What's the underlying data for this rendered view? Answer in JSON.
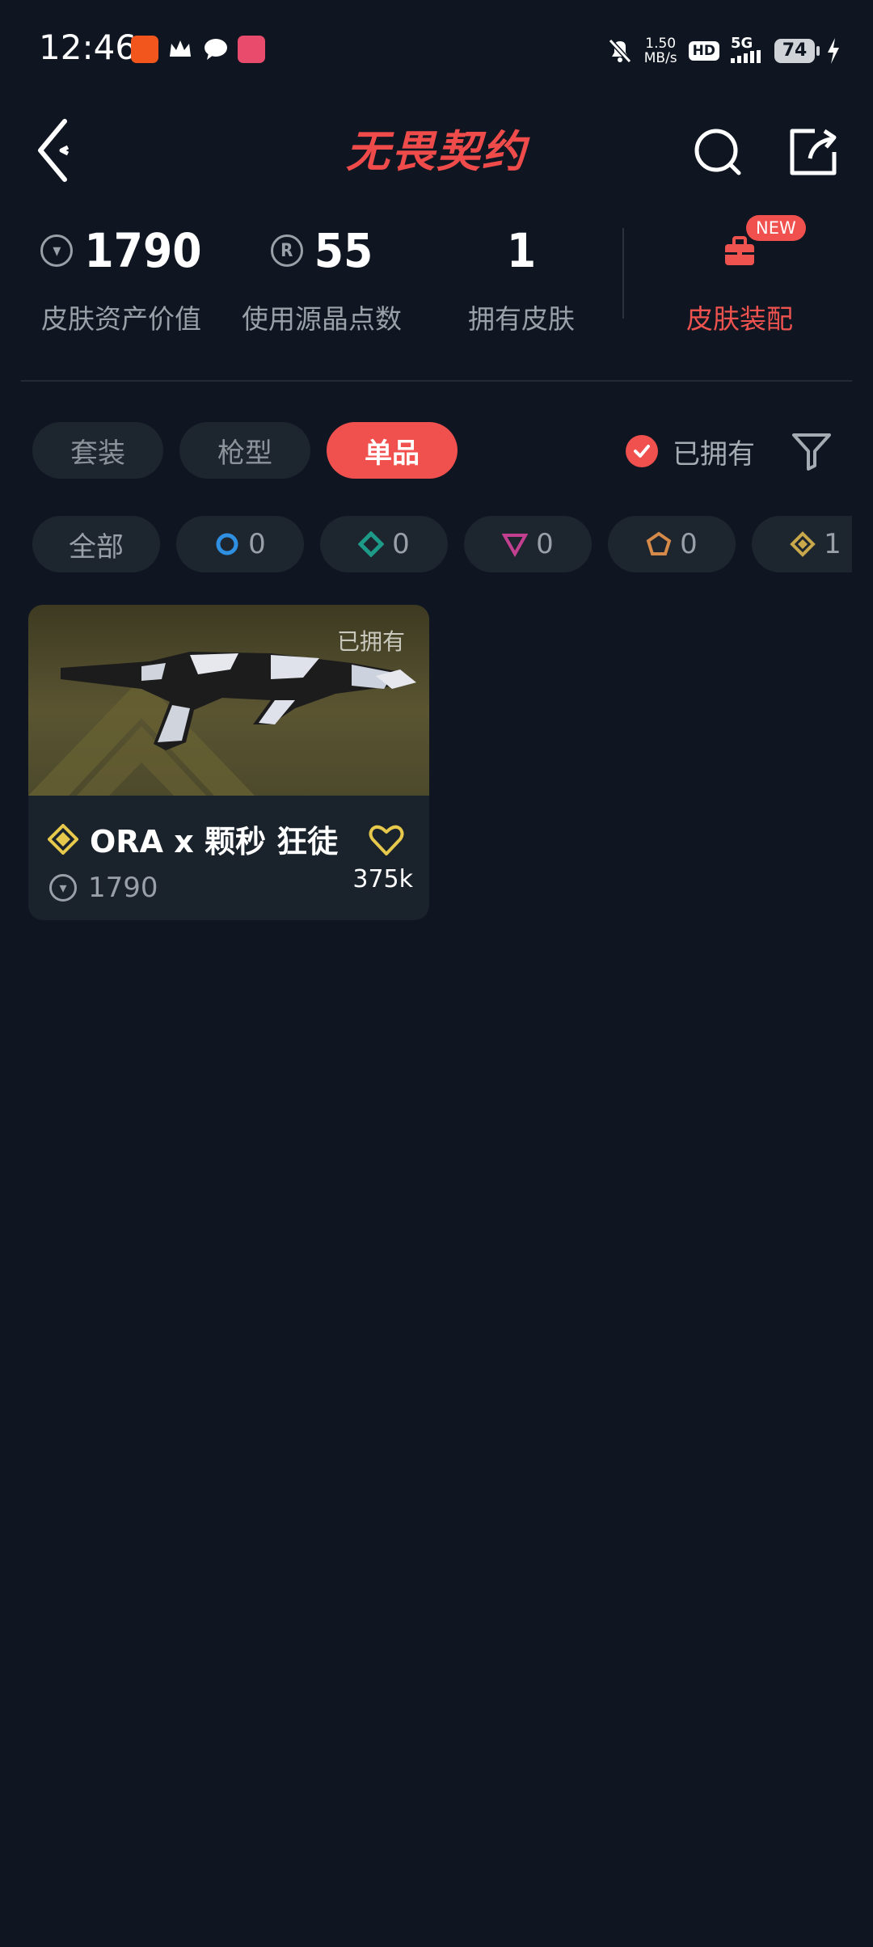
{
  "status_bar": {
    "time": "12:46",
    "net_speed_value": "1.50",
    "net_speed_unit": "MB/s",
    "hd": "HD",
    "network": "5G",
    "battery": "74"
  },
  "header": {
    "title": "无畏契约"
  },
  "stats": [
    {
      "value": "1790",
      "label": "皮肤资产价值",
      "icon": "vp-coin-icon"
    },
    {
      "value": "55",
      "label": "使用源晶点数",
      "icon": "radianite-icon"
    },
    {
      "value": "1",
      "label": "拥有皮肤"
    }
  ],
  "loadout": {
    "label": "皮肤装配",
    "badge": "NEW"
  },
  "tabs": [
    "套装",
    "枪型",
    "单品"
  ],
  "active_tab": "单品",
  "owned_filter": {
    "label": "已拥有",
    "checked": true
  },
  "rarity_chips": [
    {
      "label": "全部"
    },
    {
      "count": "0",
      "tier": "select",
      "color": "#2f8fe0"
    },
    {
      "count": "0",
      "tier": "deluxe",
      "color": "#1d9a88"
    },
    {
      "count": "0",
      "tier": "premium",
      "color": "#c2408f"
    },
    {
      "count": "0",
      "tier": "exclusive",
      "color": "#d58a4a"
    },
    {
      "count": "1",
      "tier": "ultra",
      "color": "#c8a84b"
    }
  ],
  "items": [
    {
      "name": "ORA x 颗秒 狂徒",
      "price": "1790",
      "likes": "375k",
      "owned_tag": "已拥有",
      "rarity_color": "#e6c84d"
    }
  ]
}
